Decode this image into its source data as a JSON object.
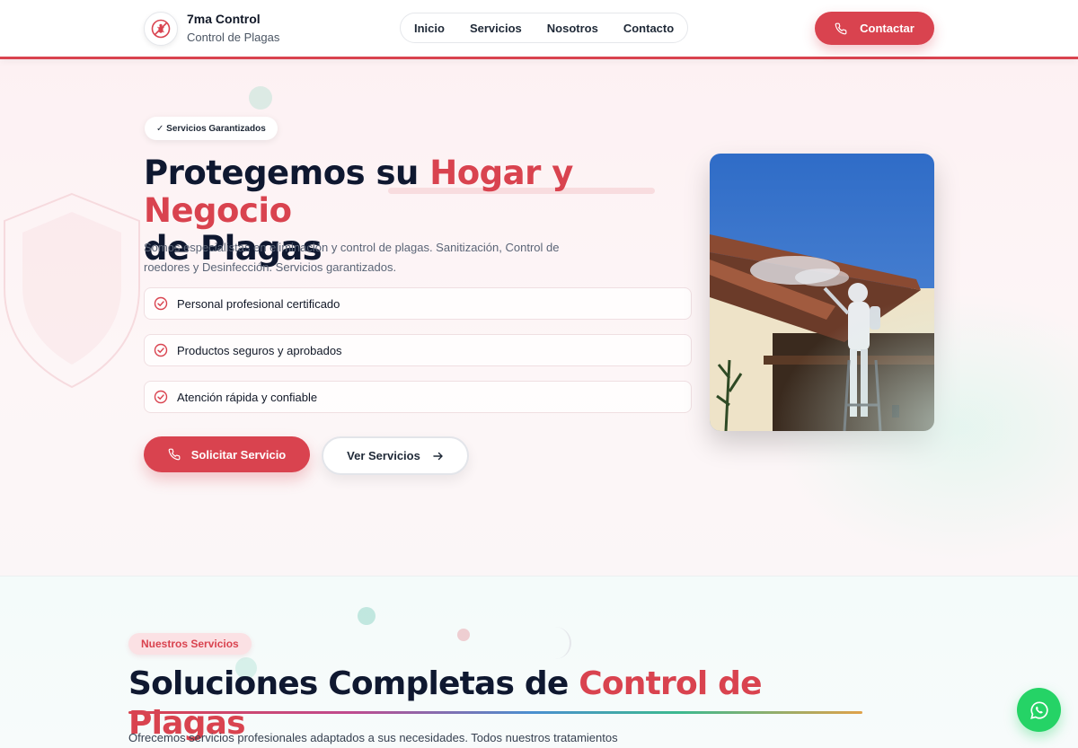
{
  "header": {
    "brand_title": "7ma Control",
    "brand_subtitle": "Control de Plagas",
    "logo_icon": "bug-crossed-icon",
    "nav": [
      "Inicio",
      "Servicios",
      "Nosotros",
      "Contacto"
    ],
    "contact_button": "Contactar",
    "accent_color": "#d9434f"
  },
  "hero": {
    "badge": "✓ Servicios Garantizados",
    "title_part1": "Protegemos su ",
    "title_highlight": "Hogar y Negocio",
    "title_part2": "de Plagas",
    "description": "Somos especialistas en eliminación y control de plagas. Sanitización, Control de roedores y Desinfección. Servicios garantizados.",
    "features": [
      "Personal profesional certificado",
      "Productos seguros y aprobados",
      "Atención rápida y confiable"
    ],
    "primary_button": "Solicitar Servicio",
    "secondary_button": "Ver Servicios"
  },
  "services": {
    "badge": "Nuestros Servicios",
    "title_part1": "Soluciones Completas de ",
    "title_highlight": "Control de Plagas",
    "description": "Ofrecemos servicios profesionales adaptados a sus necesidades. Todos nuestros tratamientos"
  },
  "floating": {
    "whatsapp_icon": "whatsapp-icon",
    "whatsapp_color": "#25d366"
  }
}
